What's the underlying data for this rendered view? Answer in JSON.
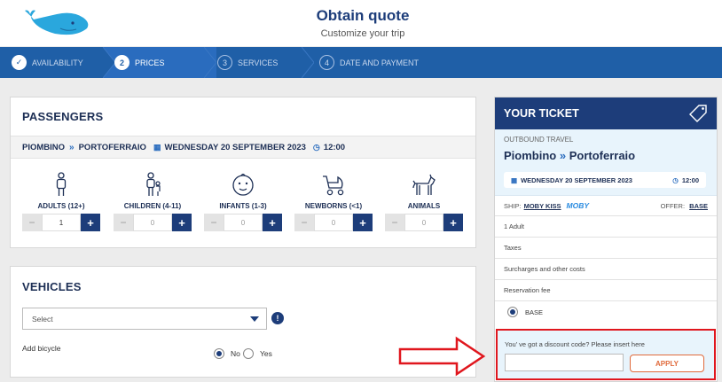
{
  "header": {
    "title": "Obtain quote",
    "subtitle": "Customize your trip"
  },
  "steps": [
    {
      "label": "AVAILABILITY",
      "num": "✓",
      "state": "done"
    },
    {
      "label": "PRICES",
      "num": "2",
      "state": "active"
    },
    {
      "label": "SERVICES",
      "num": "3",
      "state": "todo"
    },
    {
      "label": "DATE AND PAYMENT",
      "num": "4",
      "state": "todo"
    }
  ],
  "passengers": {
    "title": "PASSENGERS",
    "route_from": "PIOMBINO",
    "route_sep": "»",
    "route_to": "PORTOFERRAIO",
    "date": "WEDNESDAY 20 SEPTEMBER 2023",
    "time": "12:00",
    "types": [
      {
        "label": "ADULTS (12+)",
        "value": "1",
        "icon": "adult-icon"
      },
      {
        "label": "CHILDREN (4-11)",
        "value": "0",
        "icon": "children-icon"
      },
      {
        "label": "INFANTS (1-3)",
        "value": "0",
        "icon": "infant-icon"
      },
      {
        "label": "NEWBORNS (<1)",
        "value": "0",
        "icon": "stroller-icon"
      },
      {
        "label": "ANIMALS",
        "value": "0",
        "icon": "dog-icon"
      }
    ],
    "minus": "−",
    "plus": "+"
  },
  "vehicles": {
    "title": "VEHICLES",
    "select_value": "Select",
    "info": "!",
    "bike_label": "Add bicycle",
    "no_label": "No",
    "yes_label": "Yes",
    "bike_selected": "No"
  },
  "ticket": {
    "title": "YOUR TICKET",
    "outbound_label": "OUTBOUND TRAVEL",
    "route_from": "Piombino",
    "route_sep": "»",
    "route_to": "Portoferraio",
    "date": "WEDNESDAY 20 SEPTEMBER 2023",
    "time": "12:00",
    "ship_label": "SHIP:",
    "ship_name": "MOBY KISS",
    "ship_brand": "MOBY",
    "offer_label": "OFFER:",
    "offer_value": "BASE",
    "lines": [
      "1 Adult",
      "Taxes",
      "Surcharges and other costs",
      "Reservation fee"
    ],
    "base_option": "BASE",
    "discount_label": "You' ve got a discount code? Please insert here",
    "apply_label": "APPLY"
  },
  "colors": {
    "brand_navy": "#1d3d7a",
    "steps_blue": "#1f5fa7",
    "apply_orange": "#e06a3b",
    "highlight_red": "#e0161d"
  }
}
